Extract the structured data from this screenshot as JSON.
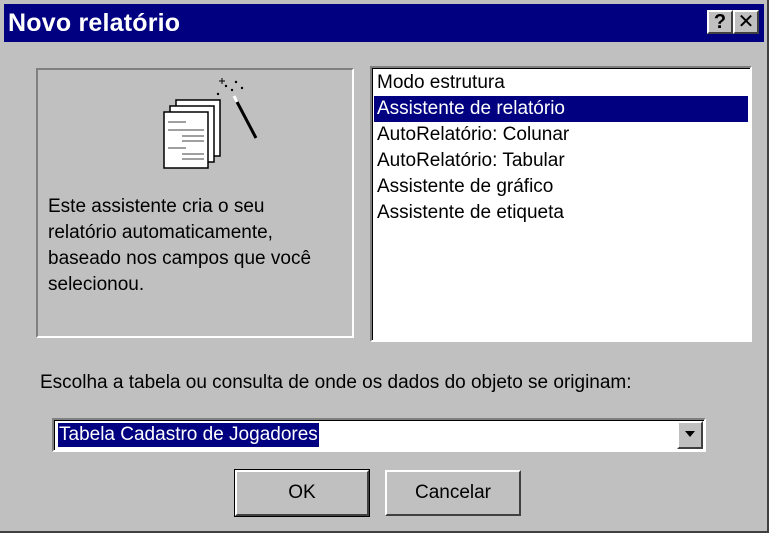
{
  "window": {
    "title": "Novo relatório",
    "help_label": "?",
    "close_label": "✕"
  },
  "preview": {
    "illustration_icon": "report-wizard-icon",
    "description": "Este assistente cria o seu relatório automaticamente, baseado nos campos que você selecionou."
  },
  "options": {
    "items": [
      {
        "label": "Modo estrutura",
        "selected": false
      },
      {
        "label": "Assistente de relatório",
        "selected": true
      },
      {
        "label": "AutoRelatório:  Colunar",
        "selected": false
      },
      {
        "label": "AutoRelatório:  Tabular",
        "selected": false
      },
      {
        "label": "Assistente de gráfico",
        "selected": false
      },
      {
        "label": "Assistente de etiqueta",
        "selected": false
      }
    ]
  },
  "source": {
    "prompt": "Escolha a tabela ou consulta de onde os dados do objeto se originam:",
    "selected_value": "Tabela Cadastro de Jogadores"
  },
  "buttons": {
    "ok_label": "OK",
    "cancel_label": "Cancelar"
  },
  "colors": {
    "title_bar": "#000080",
    "face": "#c0c0c0",
    "selection": "#000080"
  }
}
